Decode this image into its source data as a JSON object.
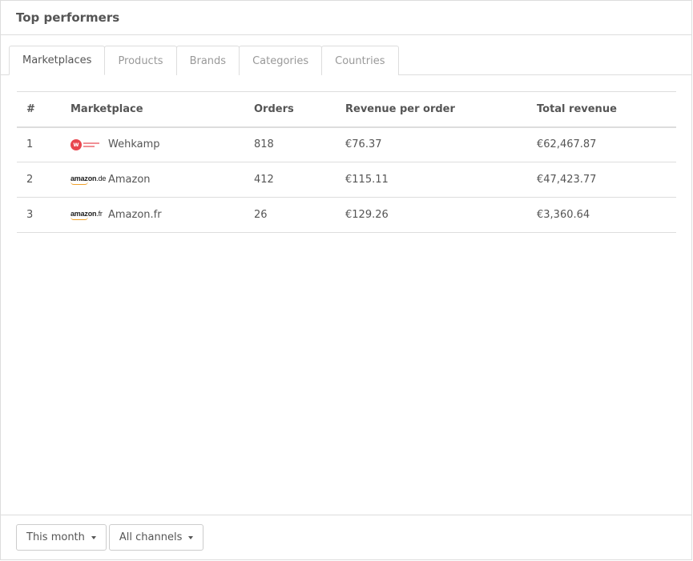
{
  "panel": {
    "title": "Top performers"
  },
  "tabs": [
    {
      "label": "Marketplaces",
      "active": true
    },
    {
      "label": "Products",
      "active": false
    },
    {
      "label": "Brands",
      "active": false
    },
    {
      "label": "Categories",
      "active": false
    },
    {
      "label": "Countries",
      "active": false
    }
  ],
  "table": {
    "columns": [
      "#",
      "Marketplace",
      "Orders",
      "Revenue per order",
      "Total revenue"
    ],
    "rows": [
      {
        "rank": "1",
        "logo": "wehkamp-logo",
        "marketplace": "Wehkamp",
        "orders": "818",
        "revenue_per_order": "€76.37",
        "total_revenue": "€62,467.87"
      },
      {
        "rank": "2",
        "logo": "amazon-de-logo",
        "logo_text": "amazon",
        "logo_tld": ".de",
        "marketplace": "Amazon",
        "orders": "412",
        "revenue_per_order": "€115.11",
        "total_revenue": "€47,423.77"
      },
      {
        "rank": "3",
        "logo": "amazon-fr-logo",
        "logo_text": "amazon",
        "logo_tld": ".fr",
        "marketplace": "Amazon.fr",
        "orders": "26",
        "revenue_per_order": "€129.26",
        "total_revenue": "€3,360.64"
      }
    ]
  },
  "footer": {
    "period_label": "This month",
    "channel_label": "All channels"
  },
  "colors": {
    "wehkamp": "#e8464f",
    "amazon_smile": "#f0a12a",
    "border": "#dddddd",
    "text": "#555555",
    "inactive_tab": "#999999"
  }
}
